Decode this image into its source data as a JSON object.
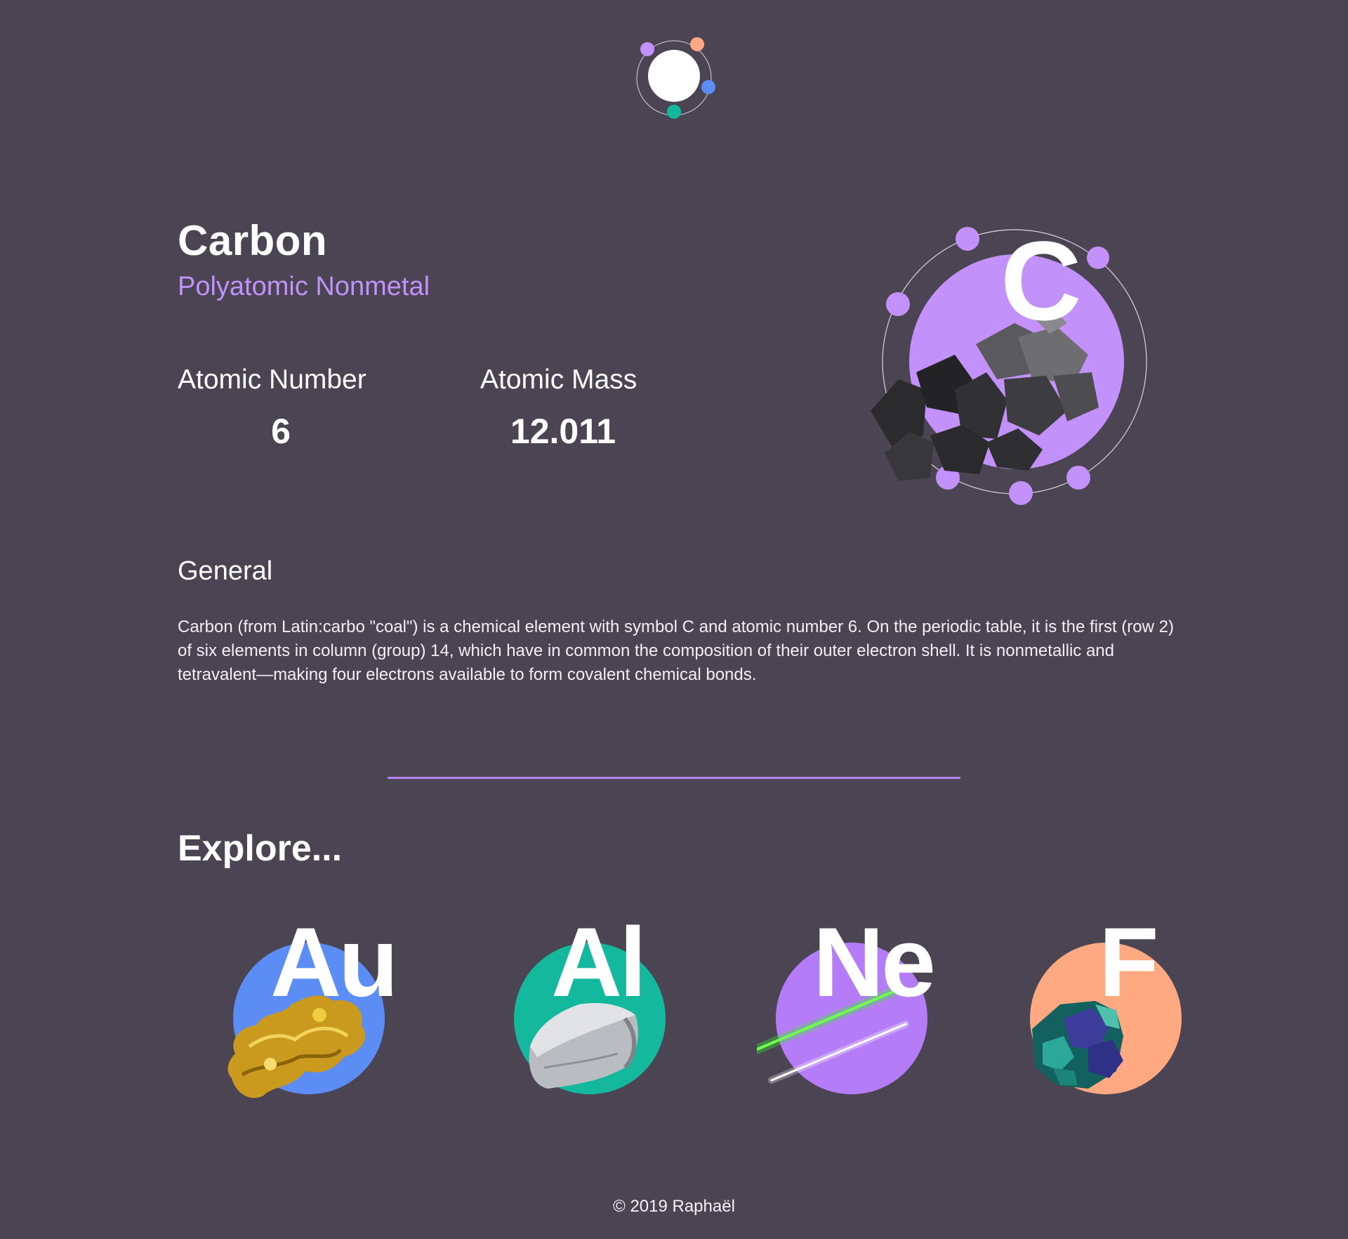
{
  "logo": {
    "icon": "atom-logo-icon"
  },
  "element": {
    "name": "Carbon",
    "category": "Polyatomic Nonmetal",
    "symbol": "C",
    "color": "#c291f9"
  },
  "stats": {
    "atomic_number_label": "Atomic Number",
    "atomic_number_value": "6",
    "atomic_mass_label": "Atomic Mass",
    "atomic_mass_value": "12.011"
  },
  "general": {
    "heading": "General",
    "text": "Carbon (from Latin:carbo \"coal\") is a chemical element with symbol C and atomic number 6. On the periodic table, it is the first (row 2) of six elements in column (group) 14, which have in common the composition of their outer electron shell. It is nonmetallic and tetravalent—making four electrons available to form covalent chemical bonds."
  },
  "explore": {
    "heading": "Explore...",
    "items": [
      {
        "symbol": "Au",
        "color": "#5b8df5",
        "icon": "gold-nugget-icon"
      },
      {
        "symbol": "Al",
        "color": "#14b89c",
        "icon": "aluminium-chunk-icon"
      },
      {
        "symbol": "Ne",
        "color": "#b57cf7",
        "icon": "neon-light-icon"
      },
      {
        "symbol": "F",
        "color": "#ffa983",
        "icon": "fluorite-crystal-icon"
      }
    ]
  },
  "footer": {
    "text": "© 2019 Raphaël"
  }
}
